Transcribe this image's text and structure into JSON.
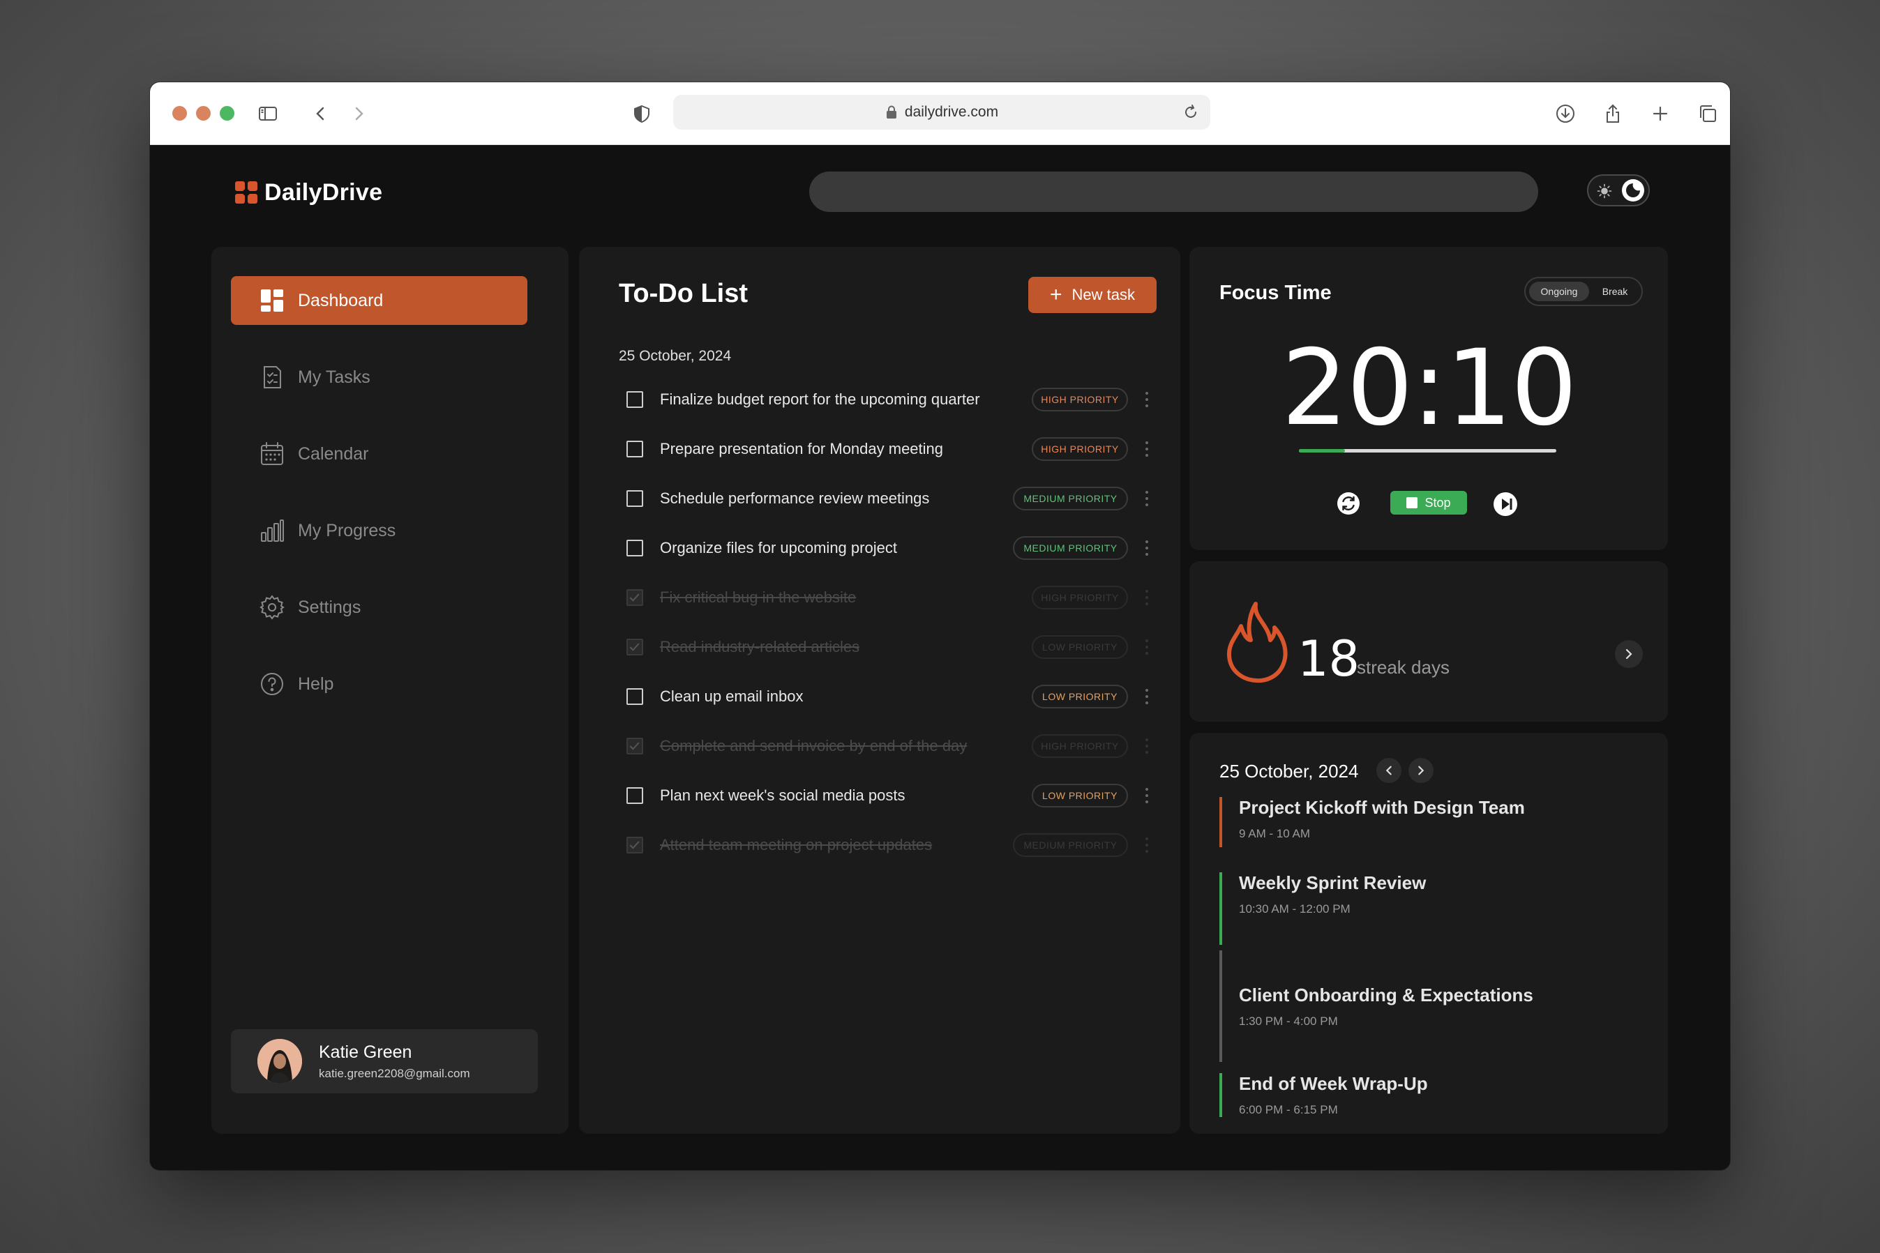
{
  "browser": {
    "url": "dailydrive.com"
  },
  "app": {
    "name": "DailyDrive"
  },
  "search": {
    "placeholder": ""
  },
  "sidebar": {
    "items": [
      {
        "label": "Dashboard"
      },
      {
        "label": "My Tasks"
      },
      {
        "label": "Calendar"
      },
      {
        "label": "My Progress"
      },
      {
        "label": "Settings"
      },
      {
        "label": "Help"
      }
    ],
    "active_index": 0
  },
  "user": {
    "name": "Katie Green",
    "email": "katie.green2208@gmail.com"
  },
  "todo": {
    "title": "To-Do List",
    "new_task_label": "New task",
    "date": "25 October, 2024",
    "tasks": [
      {
        "text": "Finalize budget report for the upcoming quarter",
        "priority": "HIGH PRIORITY",
        "done": false
      },
      {
        "text": "Prepare presentation for Monday meeting",
        "priority": "HIGH PRIORITY",
        "done": false
      },
      {
        "text": "Schedule performance review meetings",
        "priority": "MEDIUM PRIORITY",
        "done": false
      },
      {
        "text": "Organize files for upcoming project",
        "priority": "MEDIUM PRIORITY",
        "done": false
      },
      {
        "text": "Fix critical bug in the website",
        "priority": "HIGH PRIORITY",
        "done": true
      },
      {
        "text": "Read industry-related articles",
        "priority": "LOW PRIORITY",
        "done": true
      },
      {
        "text": "Clean up email inbox",
        "priority": "LOW PRIORITY",
        "done": false
      },
      {
        "text": "Complete and send invoice by end of the day",
        "priority": "HIGH PRIORITY",
        "done": true
      },
      {
        "text": "Plan next week's social media posts",
        "priority": "LOW PRIORITY",
        "done": false
      },
      {
        "text": "Attend team meeting on project updates",
        "priority": "MEDIUM PRIORITY",
        "done": true
      }
    ]
  },
  "focus": {
    "title": "Focus Time",
    "modes": [
      "Ongoing",
      "Break"
    ],
    "active_mode": "Ongoing",
    "timer": "20:10",
    "progress": 0.18,
    "stop_label": "Stop"
  },
  "streak": {
    "count": "18",
    "label": "streak days"
  },
  "schedule": {
    "date": "25 October, 2024",
    "events": [
      {
        "title": "Project Kickoff with Design Team",
        "time": "9 AM - 10 AM",
        "color": "#c0562c"
      },
      {
        "title": "Weekly Sprint Review",
        "time": "10:30 AM - 12:00 PM",
        "color": "#3cab55"
      },
      {
        "title": "Client Onboarding & Expectations",
        "time": "1:30 PM - 4:00 PM",
        "color": "#5a5a5a"
      },
      {
        "title": "End of Week Wrap-Up",
        "time": "6:00 PM - 6:15 PM",
        "color": "#3cab55"
      }
    ]
  },
  "colors": {
    "accent": "#c0562c",
    "success": "#3cab55",
    "high": "#e8875a",
    "medium": "#5fc27a",
    "low": "#e8a05a"
  }
}
